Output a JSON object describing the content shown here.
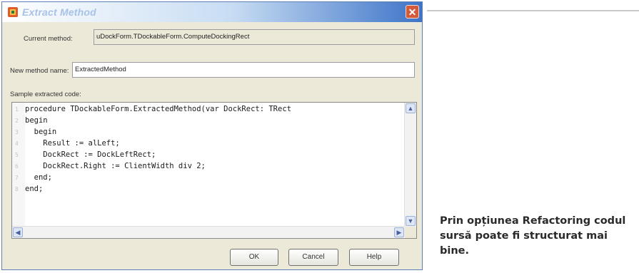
{
  "dialog": {
    "title": "Extract Method",
    "close_icon": "close-icon",
    "current_method": {
      "label": "Current method:",
      "value": "uDockForm.TDockableForm.ComputeDockingRect"
    },
    "new_method_name": {
      "label": "New method name:",
      "value": "ExtractedMethod"
    },
    "sample_label": "Sample extracted code:",
    "code_lines": [
      {
        "n": "1",
        "text": "procedure TDockableForm.ExtractedMethod(var DockRect: TRect"
      },
      {
        "n": "2",
        "text": "begin"
      },
      {
        "n": "3",
        "text": "  begin"
      },
      {
        "n": "4",
        "text": "    Result := alLeft;"
      },
      {
        "n": "5",
        "text": "    DockRect := DockLeftRect;"
      },
      {
        "n": "6",
        "text": "    DockRect.Right := ClientWidth div 2;"
      },
      {
        "n": "7",
        "text": "  end;"
      },
      {
        "n": "8",
        "text": "end;"
      }
    ],
    "buttons": {
      "ok": "OK",
      "cancel": "Cancel",
      "help": "Help"
    }
  },
  "caption": "Prin opțiunea Refactoring codul sursă poate fi structurat mai bine."
}
